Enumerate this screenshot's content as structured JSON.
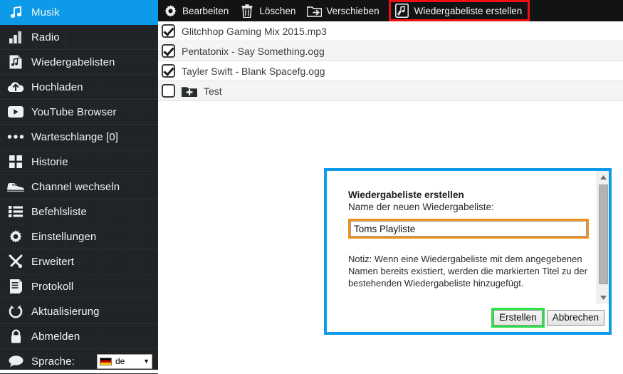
{
  "sidebar": {
    "items": [
      {
        "label": "Musik",
        "icon": "music-note-icon",
        "active": true
      },
      {
        "label": "Radio",
        "icon": "bar-chart-icon",
        "active": false
      },
      {
        "label": "Wiedergabelisten",
        "icon": "playlist-icon",
        "active": false
      },
      {
        "label": "Hochladen",
        "icon": "cloud-upload-icon",
        "active": false
      },
      {
        "label": "YouTube Browser",
        "icon": "youtube-play-icon",
        "active": false
      },
      {
        "label": "Warteschlange [0]",
        "icon": "ellipsis-icon",
        "active": false
      },
      {
        "label": "Historie",
        "icon": "grid-squares-icon",
        "active": false
      },
      {
        "label": "Channel wechseln",
        "icon": "shoe-icon",
        "active": false
      },
      {
        "label": "Befehlsliste",
        "icon": "list-icon",
        "active": false
      },
      {
        "label": "Einstellungen",
        "icon": "gear-icon",
        "active": false
      },
      {
        "label": "Erweitert",
        "icon": "tools-cross-icon",
        "active": false
      },
      {
        "label": "Protokoll",
        "icon": "document-icon",
        "active": false
      },
      {
        "label": "Aktualisierung",
        "icon": "refresh-circle-icon",
        "active": false
      },
      {
        "label": "Abmelden",
        "icon": "lock-icon",
        "active": false
      }
    ],
    "language": {
      "label": "Sprache:",
      "icon": "speech-bubble-icon",
      "selected": "de",
      "flag": "german-flag-icon",
      "caret": "▼"
    }
  },
  "toolbar": {
    "buttons": [
      {
        "label": "Bearbeiten",
        "icon": "gear-icon",
        "highlighted": false
      },
      {
        "label": "Löschen",
        "icon": "trash-icon",
        "highlighted": false
      },
      {
        "label": "Verschieben",
        "icon": "move-folder-icon",
        "highlighted": false
      },
      {
        "label": "Wiedergabeliste erstellen",
        "icon": "add-playlist-icon",
        "highlighted": true
      }
    ],
    "highlight_color": "#ee1111"
  },
  "filelist": {
    "rows": [
      {
        "name": "Glitchhop Gaming Mix 2015.mp3",
        "checked": true,
        "is_folder": false
      },
      {
        "name": "Pentatonix - Say Something.ogg",
        "checked": true,
        "is_folder": false
      },
      {
        "name": "Tayler Swift - Blank Spacefg.ogg",
        "checked": true,
        "is_folder": false
      },
      {
        "name": "Test",
        "checked": false,
        "is_folder": true
      }
    ]
  },
  "dialog": {
    "title": "Wiedergabeliste erstellen",
    "subtitle": "Name der neuen Wiedergabeliste:",
    "input_value": "Toms Playliste",
    "input_placeholder": "",
    "note": "Notiz: Wenn eine Wiedergabeliste mit dem angegebenen Namen bereits existiert, werden die markierten Titel zu der bestehenden Wiedergabeliste hinzugefügt.",
    "primary_button": "Erstellen",
    "secondary_button": "Abbrechen",
    "border_color": "#0d9ae8",
    "input_highlight_color": "#f0921e",
    "primary_highlight_color": "#2fe14a",
    "scrollbar": {
      "up_arrow": "▲",
      "down_arrow": "▼"
    }
  }
}
